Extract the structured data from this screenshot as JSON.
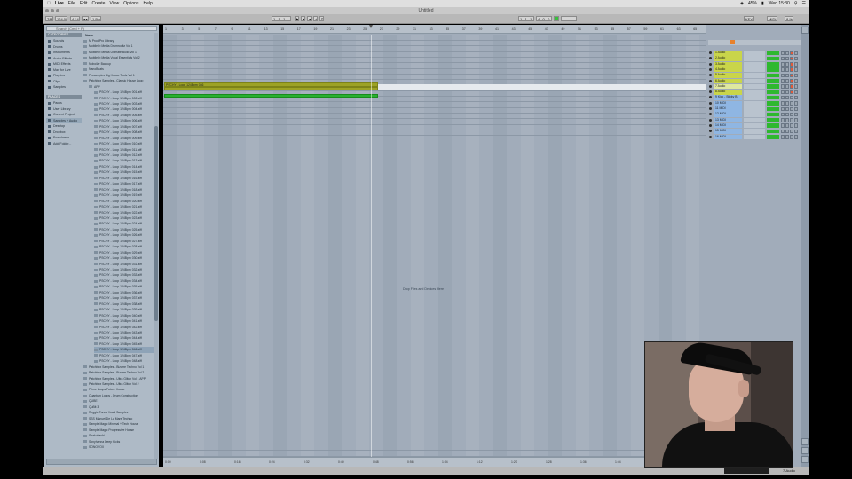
{
  "menubar": {
    "items": [
      "Live",
      "File",
      "Edit",
      "Create",
      "View",
      "Options",
      "Help"
    ],
    "clock": "Wed 15:30",
    "battery": "45%"
  },
  "window": {
    "title": "Untitled"
  },
  "control": {
    "tap": "TAP",
    "tempo": "124.00",
    "signature": "4 / 4",
    "metronome": "●●",
    "quantize": "1 Bar",
    "position": "1 . 1 . 1",
    "loop_start": "1 . 1 . 1",
    "loop_length": "4 . 0 . 0",
    "key": "KEY",
    "midi": "MIDI",
    "cpu": "8 %"
  },
  "browser": {
    "search_placeholder": "Search (Cmd + F)",
    "categories_header": "CATEGORIES",
    "categories": [
      "Sounds",
      "Drums",
      "Instruments",
      "Audio Effects",
      "MIDI Effects",
      "Max for Live",
      "Plug-ins",
      "Clips",
      "Samples"
    ],
    "places_header": "PLACES",
    "places": [
      "Packs",
      "User Library",
      "Current Project",
      "Samples + Audio",
      "Desktop",
      "Dropbox",
      "Downloads",
      "Add Folder..."
    ],
    "name_header": "Name",
    "folders_top": [
      "M Prod Pro Library",
      "Mobilelib Media Drumrooltz Vol 1",
      "Mobilelib Media Ultimate Build Vol 1",
      "Mobilelib Media Vocal Essentials Vol 2",
      "Noboilar Backup",
      "NanoBeats",
      "Prosamples Big House Tools Vol 1",
      "Patchbox Samples - Classic House Loop"
    ],
    "subfolder": "APP",
    "files_prefix": "PSCHY - Loop 124Bpm",
    "files": [
      "PSCHY - Loop 124Bpm 001.aiff",
      "PSCHY - Loop 124Bpm 002.aiff",
      "PSCHY - Loop 124Bpm 003.aiff",
      "PSCHY - Loop 124Bpm 004.aiff",
      "PSCHY - Loop 124Bpm 005.aiff",
      "PSCHY - Loop 124Bpm 006.aiff",
      "PSCHY - Loop 124Bpm 007.aiff",
      "PSCHY - Loop 124Bpm 008.aiff",
      "PSCHY - Loop 124Bpm 009.aiff",
      "PSCHY - Loop 124Bpm 010.aiff",
      "PSCHY - Loop 124Bpm 011.aiff",
      "PSCHY - Loop 124Bpm 012.aiff",
      "PSCHY - Loop 124Bpm 013.aiff",
      "PSCHY - Loop 124Bpm 014.aiff",
      "PSCHY - Loop 124Bpm 015.aiff",
      "PSCHY - Loop 124Bpm 016.aiff",
      "PSCHY - Loop 124Bpm 017.aiff",
      "PSCHY - Loop 124Bpm 018.aiff",
      "PSCHY - Loop 124Bpm 019.aiff",
      "PSCHY - Loop 124Bpm 020.aiff",
      "PSCHY - Loop 124Bpm 021.aiff",
      "PSCHY - Loop 124Bpm 022.aiff",
      "PSCHY - Loop 124Bpm 023.aiff",
      "PSCHY - Loop 124Bpm 024.aiff",
      "PSCHY - Loop 124Bpm 025.aiff",
      "PSCHY - Loop 124Bpm 026.aiff",
      "PSCHY - Loop 124Bpm 027.aiff",
      "PSCHY - Loop 124Bpm 028.aiff",
      "PSCHY - Loop 124Bpm 029.aiff",
      "PSCHY - Loop 124Bpm 030.aiff",
      "PSCHY - Loop 124Bpm 031.aiff",
      "PSCHY - Loop 124Bpm 032.aiff",
      "PSCHY - Loop 124Bpm 033.aiff",
      "PSCHY - Loop 124Bpm 034.aiff",
      "PSCHY - Loop 124Bpm 035.aiff",
      "PSCHY - Loop 124Bpm 036.aiff",
      "PSCHY - Loop 124Bpm 037.aiff",
      "PSCHY - Loop 124Bpm 038.aiff",
      "PSCHY - Loop 124Bpm 039.aiff",
      "PSCHY - Loop 124Bpm 040.aiff",
      "PSCHY - Loop 124Bpm 041.aiff",
      "PSCHY - Loop 124Bpm 042.aiff",
      "PSCHY - Loop 124Bpm 043.aiff",
      "PSCHY - Loop 124Bpm 044.aiff",
      "PSCHY - Loop 124Bpm 045.aiff",
      "PSCHY - Loop 124Bpm 046.aiff",
      "PSCHY - Loop 124Bpm 047.aiff",
      "PSCHY - Loop 124Bpm 048.aiff"
    ],
    "selected_file_index": 45,
    "folders_bottom": [
      "Patchbox Samples - Bizarre Techno Vol 1",
      "Patchbox Samples - Bizarre Techno Vol 2",
      "Patchbox Samples - Ultra Glitch Vol 1 APP",
      "Patchbox Samples - Ultra Glitch Vol 2",
      "Prime Loops Future House",
      "Quantum Loops - Drum Construction",
      "QUBE",
      "QuBit 3",
      "Reggie Tunes Vocal Samples",
      "SSS Manuel De La Mare Techno",
      "Sample Magic Minimal + Tech House",
      "Sample Magic Progressive House",
      "Shakuhachi",
      "Sonyhanna Deep Kicks",
      "SONOVOX"
    ]
  },
  "arrangement": {
    "ruler": [
      "1",
      "3",
      "5",
      "7",
      "9",
      "11",
      "13",
      "15",
      "17",
      "19",
      "21",
      "23",
      "25",
      "27",
      "29",
      "31",
      "33",
      "35",
      "37",
      "39",
      "41",
      "43",
      "45",
      "47",
      "49",
      "51",
      "53",
      "55",
      "57",
      "59",
      "61",
      "63",
      "65"
    ],
    "times": [
      "0:00",
      "0:08",
      "0:16",
      "0:24",
      "0:32",
      "0:40",
      "0:48",
      "0:56",
      "1:04",
      "1:12",
      "1:20",
      "1:28",
      "1:36",
      "1:44",
      "1:52"
    ],
    "clip_label": "PSCHY - Loop 124Bpm 046",
    "drop_hint": "Drop Files and Devices Here"
  },
  "mixer": {
    "master": "Master",
    "tracks": [
      {
        "name": "1 Audio",
        "color": "#c9d54a"
      },
      {
        "name": "2 Audio",
        "color": "#c9d54a"
      },
      {
        "name": "3 Audio",
        "color": "#c9d54a"
      },
      {
        "name": "4 Audio",
        "color": "#c9d54a"
      },
      {
        "name": "5 Audio",
        "color": "#c9d54a"
      },
      {
        "name": "6 Audio",
        "color": "#c9d54a"
      },
      {
        "name": "7 Audio",
        "color": "#dfe8a0"
      },
      {
        "name": "8 Audio",
        "color": "#c9d54a"
      },
      {
        "name": "9 Kick - Sticky B",
        "color": "#8fb6e3"
      },
      {
        "name": "10 MIDI",
        "color": "#8fb6e3"
      },
      {
        "name": "11 MIDI",
        "color": "#8fb6e3"
      },
      {
        "name": "12 MIDI",
        "color": "#8fb6e3"
      },
      {
        "name": "13 MIDI",
        "color": "#8fb6e3"
      },
      {
        "name": "14 MIDI",
        "color": "#8fb6e3"
      },
      {
        "name": "15 MIDI",
        "color": "#8fb6e3"
      },
      {
        "name": "16 MIDI",
        "color": "#8fb6e3"
      }
    ]
  },
  "status": {
    "track_label": "7-Audio"
  },
  "colors": {
    "clip_olive": "#9da225",
    "clip_green": "#28b02f",
    "arrange_bg": "#a1acba",
    "browser_bg": "#aebac6"
  }
}
